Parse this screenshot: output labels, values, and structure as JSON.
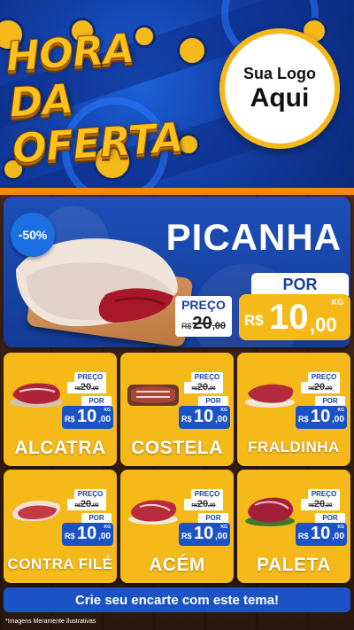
{
  "header": {
    "title_line1": "HORA DA",
    "title_line2": "OFERTA",
    "logo_line1": "Sua Logo",
    "logo_line2": "Aqui"
  },
  "hero": {
    "discount": "-50%",
    "name": "PICANHA",
    "old_label": "PREÇO",
    "old_currency": "R$",
    "old_value": "20",
    "old_cents": ",00",
    "new_label": "POR",
    "currency": "R$",
    "value": "10",
    "cents": ",00",
    "unit": "KG"
  },
  "products": [
    {
      "name": "ALCATRA",
      "old_label": "PREÇO",
      "old_currency": "R$",
      "old_value": "20",
      "old_cents": ",00",
      "new_label": "POR",
      "currency": "R$",
      "value": "10",
      "cents": ",00",
      "unit": "KG"
    },
    {
      "name": "COSTELA",
      "old_label": "PREÇO",
      "old_currency": "R$",
      "old_value": "20",
      "old_cents": ",00",
      "new_label": "POR",
      "currency": "R$",
      "value": "10",
      "cents": ",00",
      "unit": "KG"
    },
    {
      "name": "FRALDINHA",
      "old_label": "PREÇO",
      "old_currency": "R$",
      "old_value": "20",
      "old_cents": ",00",
      "new_label": "POR",
      "currency": "R$",
      "value": "10",
      "cents": ",00",
      "unit": "KG"
    },
    {
      "name": "CONTRA FILÉ",
      "old_label": "PREÇO",
      "old_currency": "R$",
      "old_value": "20",
      "old_cents": ",00",
      "new_label": "POR",
      "currency": "R$",
      "value": "10",
      "cents": ",00",
      "unit": "KG"
    },
    {
      "name": "ACÉM",
      "old_label": "PREÇO",
      "old_currency": "R$",
      "old_value": "20",
      "old_cents": ",00",
      "new_label": "POR",
      "currency": "R$",
      "value": "10",
      "cents": ",00",
      "unit": "KG"
    },
    {
      "name": "PALETA",
      "old_label": "PREÇO",
      "old_currency": "R$",
      "old_value": "20",
      "old_cents": ",00",
      "new_label": "POR",
      "currency": "R$",
      "value": "10",
      "cents": ",00",
      "unit": "KG"
    }
  ],
  "cta": {
    "label": "Crie seu encarte com este tema!"
  },
  "footer": {
    "disclaimer": "*Imagens Meramente Ilustrativas"
  },
  "colors": {
    "header_blue": "#123fa6",
    "title_yellow": "#ffc21a",
    "card_yellow": "#f6b91a",
    "price_blue": "#1b53c7",
    "accent_orange": "#f28a0d"
  }
}
